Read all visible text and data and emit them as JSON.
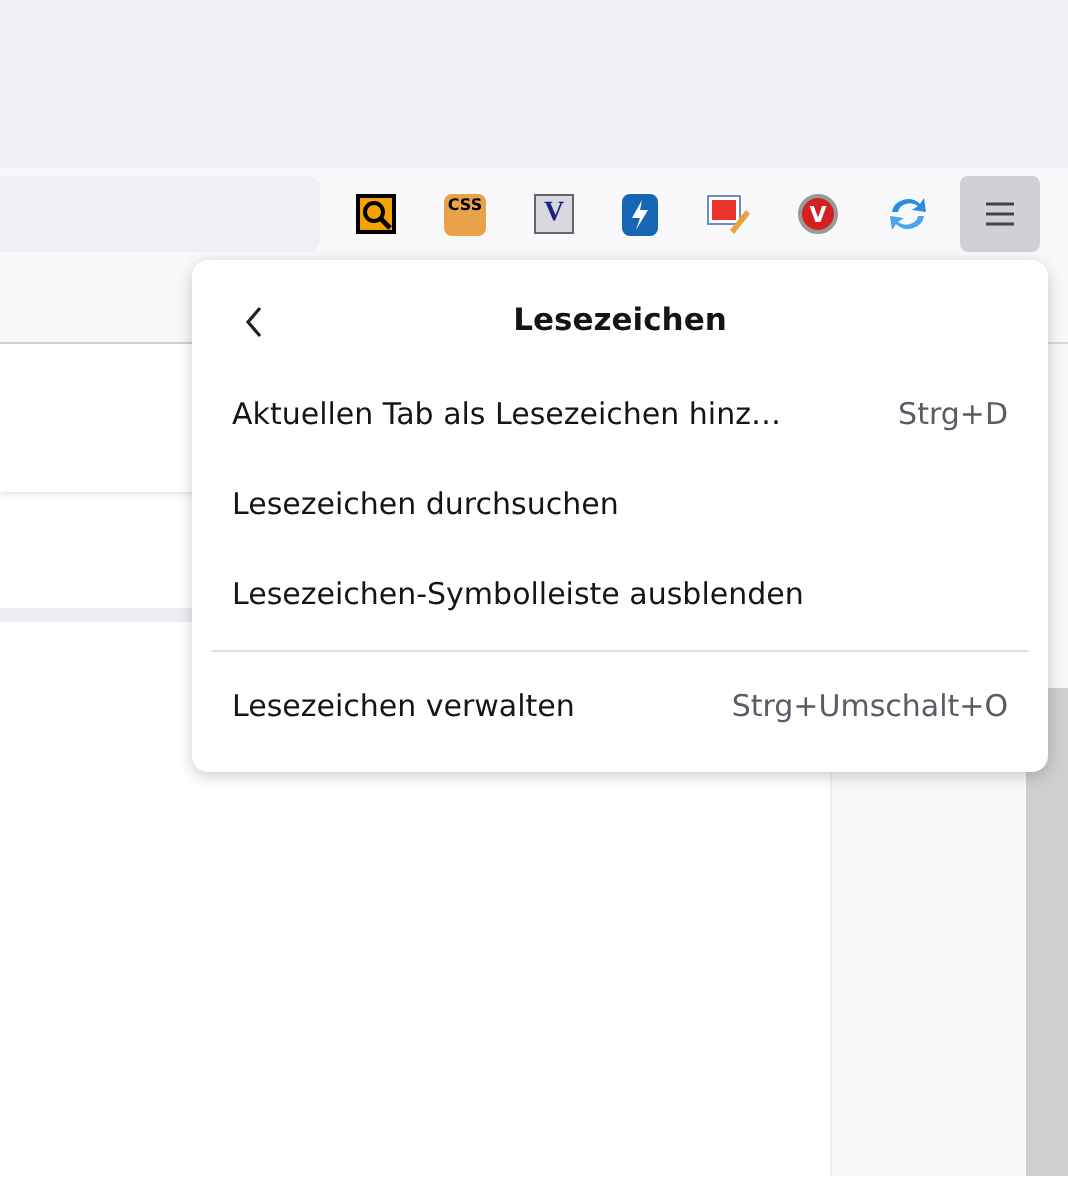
{
  "toolbar": {
    "extensions": [
      {
        "kind": "magnifier"
      },
      {
        "kind": "css",
        "label": "CSS"
      },
      {
        "kind": "letter",
        "label": "V"
      },
      {
        "kind": "bolt"
      },
      {
        "kind": "paint"
      },
      {
        "kind": "round",
        "label": "V"
      },
      {
        "kind": "sync"
      }
    ],
    "menu_button": {
      "open": true
    }
  },
  "bookmarks_menu": {
    "title": "Lesezeichen",
    "items": [
      {
        "label": "Aktuellen Tab als Lesezeichen hinz…",
        "shortcut": "Strg+D"
      },
      {
        "label": "Lesezeichen durchsuchen"
      },
      {
        "label": "Lesezeichen-Symbolleiste ausblenden",
        "divider_after": true
      },
      {
        "label": "Lesezeichen verwalten",
        "shortcut": "Strg+Umschalt+O"
      }
    ]
  }
}
